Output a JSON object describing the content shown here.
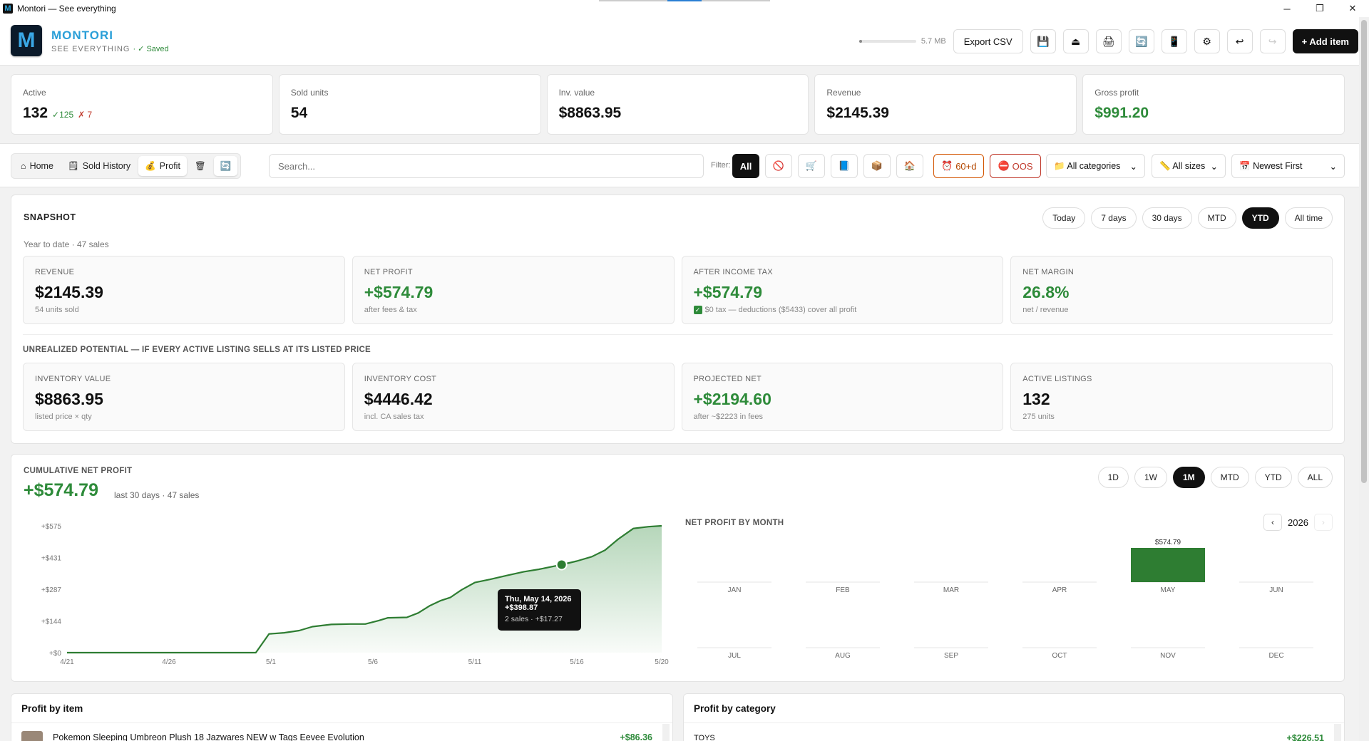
{
  "window": {
    "title": "Montori — See everything",
    "controls": [
      "─",
      "❐",
      "✕"
    ]
  },
  "header": {
    "logo_letter": "M",
    "brand": "MONTORI",
    "tagline": "SEE EVERYTHING",
    "saved": "· ✓ Saved",
    "storage": {
      "label": "5.7 MB",
      "fill": 0.05
    },
    "export_label": "Export CSV",
    "add_label": "+ Add item",
    "icons": [
      "💾",
      "⏏",
      "🖨",
      "🔄",
      "📱",
      "⚙",
      "↩",
      "↪"
    ]
  },
  "stats": [
    {
      "label": "Active",
      "value": "132",
      "ok": "✓125",
      "bad": "✗ 7"
    },
    {
      "label": "Sold units",
      "value": "54"
    },
    {
      "label": "Inv. value",
      "value": "$8863.95"
    },
    {
      "label": "Revenue",
      "value": "$2145.39"
    },
    {
      "label": "Gross profit",
      "value": "$991.20"
    }
  ],
  "nav": {
    "home": "Home",
    "sold": "Sold History",
    "profit": "Profit",
    "home_icon": "⌂",
    "sold_icon": "🗒",
    "profit_icon": "💰",
    "trash_icon": "🗑",
    "sync_icon": "🔄"
  },
  "search": {
    "placeholder": "Search..."
  },
  "filters": {
    "label": "Filter:",
    "all": "All",
    "icons": [
      "🚫",
      "🛒",
      "📘",
      "📦",
      "🏠"
    ],
    "aged": "60+d",
    "aged_icon": "⏰",
    "oos": "OOS",
    "oos_icon": "⛔"
  },
  "selects": {
    "categories": "All categories",
    "categories_icon": "📁",
    "sizes": "All sizes",
    "sizes_icon": "📏",
    "sort": "Newest First",
    "sort_icon": "📅",
    "caret": "⌄"
  },
  "snapshot": {
    "title": "SNAPSHOT",
    "subtitle": "Year to date · 47 sales",
    "ranges": [
      "Today",
      "7 days",
      "30 days",
      "MTD",
      "YTD",
      "All time"
    ],
    "metrics": [
      {
        "label": "REVENUE",
        "value": "$2145.39",
        "sub": "54 units sold"
      },
      {
        "label": "NET PROFIT",
        "value": "+$574.79",
        "sub": "after fees & tax"
      },
      {
        "label": "AFTER INCOME TAX",
        "value": "+$574.79",
        "sub": "$0 tax — deductions ($5433) cover all profit"
      },
      {
        "label": "NET MARGIN",
        "value": "26.8%",
        "sub": "net / revenue"
      }
    ],
    "unrealized_title": "UNREALIZED POTENTIAL — IF EVERY ACTIVE LISTING SELLS AT ITS LISTED PRICE",
    "unrealized": [
      {
        "label": "INVENTORY VALUE",
        "value": "$8863.95",
        "sub": "listed price × qty"
      },
      {
        "label": "INVENTORY COST",
        "value": "$4446.42",
        "sub": "incl. CA sales tax"
      },
      {
        "label": "PROJECTED NET",
        "value": "+$2194.60",
        "sub": "after ~$2223 in fees"
      },
      {
        "label": "ACTIVE LISTINGS",
        "value": "132",
        "sub": "275 units"
      }
    ]
  },
  "cumulative": {
    "title": "CUMULATIVE NET PROFIT",
    "value": "+$574.79",
    "sub": "last 30 days · 47 sales",
    "ranges": [
      "1D",
      "1W",
      "1M",
      "MTD",
      "YTD",
      "ALL"
    ],
    "tooltip": {
      "date": "Thu, May 14, 2026",
      "value": "+$398.87",
      "detail": "2 sales · +$17.27"
    }
  },
  "monthly": {
    "title": "NET PROFIT BY MONTH",
    "year": "2026",
    "prev": "‹",
    "next": "›"
  },
  "chart_data": [
    {
      "type": "area",
      "title": "CUMULATIVE NET PROFIT",
      "y_ticks": [
        "+$575",
        "+$431",
        "+$287",
        "+$144",
        "+$0"
      ],
      "y_tick_values": [
        575,
        431,
        287,
        144,
        0
      ],
      "x_ticks": [
        "4/21",
        "4/26",
        "5/1",
        "5/6",
        "5/11",
        "5/16",
        "5/20"
      ],
      "x_tick_days": [
        0,
        5,
        10,
        15,
        20,
        25,
        29
      ],
      "ylim": [
        0,
        575
      ],
      "xlim": [
        0,
        29
      ],
      "series": [
        {
          "points": [
            [
              0,
              0
            ],
            [
              1,
              0
            ],
            [
              2,
              0
            ],
            [
              3,
              0
            ],
            [
              4,
              0
            ],
            [
              5,
              0
            ],
            [
              6,
              0
            ],
            [
              7,
              0
            ],
            [
              8,
              0
            ],
            [
              9,
              0
            ],
            [
              10,
              0
            ],
            [
              10.7,
              85
            ],
            [
              11.5,
              90
            ],
            [
              12.3,
              100
            ],
            [
              13,
              118
            ],
            [
              14,
              128
            ],
            [
              15,
              130
            ],
            [
              15.8,
              130
            ],
            [
              16.5,
              145
            ],
            [
              17,
              158
            ],
            [
              18,
              160
            ],
            [
              18.6,
              180
            ],
            [
              19.2,
              212
            ],
            [
              19.8,
              236
            ],
            [
              20.3,
              250
            ],
            [
              20.9,
              285
            ],
            [
              21.6,
              318
            ],
            [
              22.4,
              332
            ],
            [
              23.3,
              350
            ],
            [
              24.2,
              367
            ],
            [
              25,
              378
            ],
            [
              25.8,
              392
            ],
            [
              26.2,
              399
            ],
            [
              27,
              415
            ],
            [
              27.8,
              435
            ],
            [
              28.5,
              465
            ],
            [
              29.2,
              515
            ],
            [
              30,
              563
            ],
            [
              30.8,
              571
            ],
            [
              31.5,
              575
            ]
          ]
        }
      ],
      "highlight": {
        "x": 26.2,
        "y": 398.87
      }
    },
    {
      "type": "bar",
      "title": "NET PROFIT BY MONTH",
      "categories": [
        "JAN",
        "FEB",
        "MAR",
        "APR",
        "MAY",
        "JUN",
        "JUL",
        "AUG",
        "SEP",
        "OCT",
        "NOV",
        "DEC"
      ],
      "values": [
        0,
        0,
        0,
        0,
        574.79,
        0,
        0,
        0,
        0,
        0,
        0,
        0
      ],
      "labels": [
        "",
        "",
        "",
        "",
        "$574.79",
        "",
        "",
        "",
        "",
        "",
        "",
        ""
      ],
      "bar_color": "#2e7d32"
    }
  ],
  "profit_by_item": {
    "title": "Profit by item",
    "rows": [
      {
        "name": "Pokemon Sleeping Umbreon Plush 18 Jazwares NEW w Tags Eevee Evolution",
        "amount": "+$86.36"
      }
    ]
  },
  "profit_by_category": {
    "title": "Profit by category",
    "rows": [
      {
        "name": "TOYS",
        "amount": "+$226.51"
      }
    ]
  },
  "colors": {
    "accent": "#2a9fd8",
    "green": "#2e8b3a",
    "dark": "#111111",
    "warn": "#d35400",
    "danger": "#c0392b"
  }
}
